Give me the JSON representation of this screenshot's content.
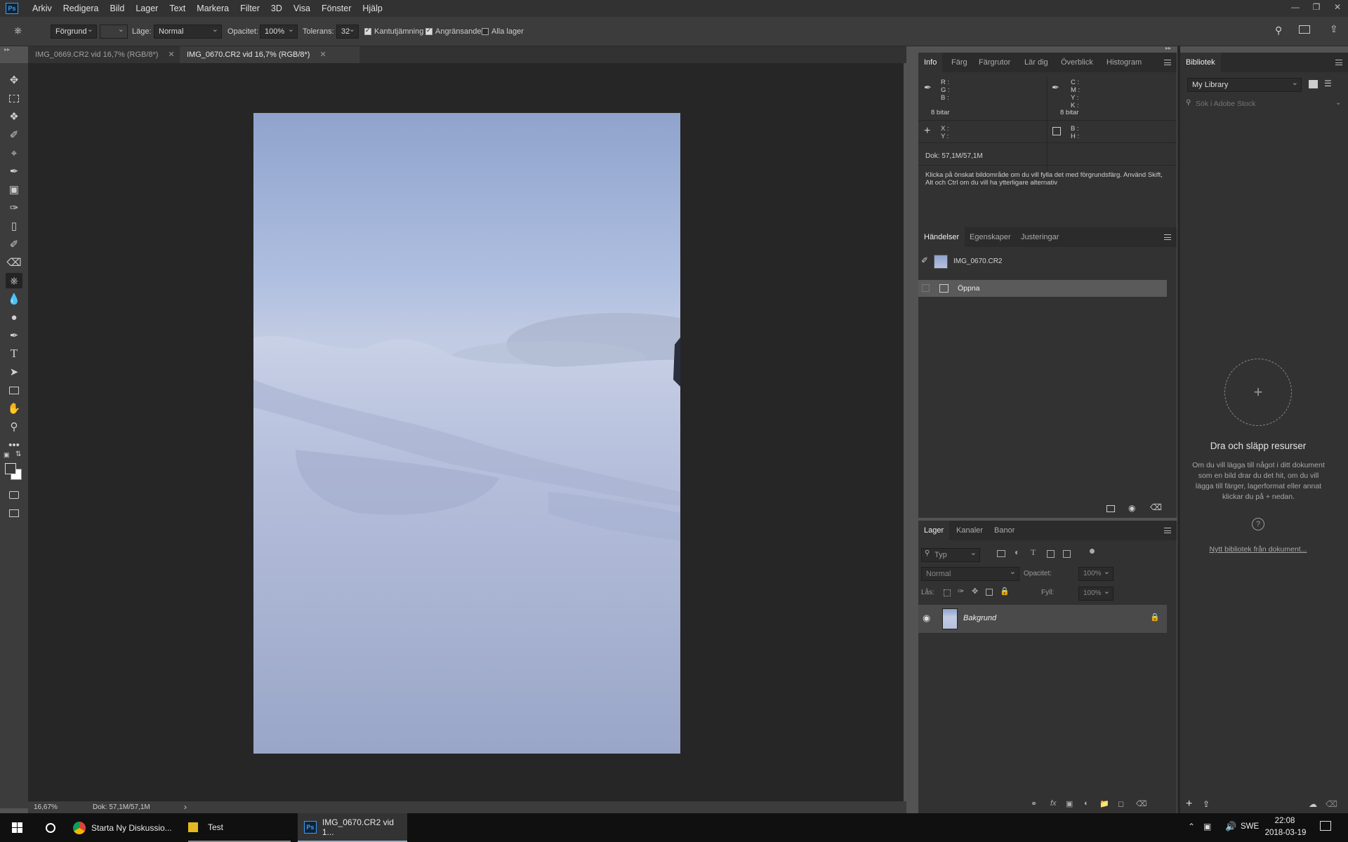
{
  "app": {
    "logo": "Ps",
    "menu": [
      "Arkiv",
      "Redigera",
      "Bild",
      "Lager",
      "Text",
      "Markera",
      "Filter",
      "3D",
      "Visa",
      "Fönster",
      "Hjälp"
    ]
  },
  "options": {
    "fill_source": "Förgrund",
    "mode_label": "Läge:",
    "mode_value": "Normal",
    "opacity_label": "Opacitet:",
    "opacity_value": "100%",
    "tolerance_label": "Tolerans:",
    "tolerance_value": "32",
    "antialias_label": "Kantutjämning",
    "contiguous_label": "Angränsande",
    "all_layers_label": "Alla lager"
  },
  "tabs": [
    {
      "label": "IMG_0669.CR2 vid 16,7% (RGB/8*)"
    },
    {
      "label": "IMG_0670.CR2 vid 16,7% (RGB/8*)"
    }
  ],
  "status": {
    "zoom": "16,67%",
    "doc": "Dok: 57,1M/57,1M",
    "arrow": "›"
  },
  "info_panel": {
    "tabs": [
      "Info",
      "Färg",
      "Färgrutor",
      "Lär dig",
      "Överblick",
      "Histogram"
    ],
    "rgb": "R :\nG :\nB :",
    "cmyk": "C :\nM :\nY :\nK :",
    "bits_left": "8 bitar",
    "bits_right": "8 bitar",
    "xy": "X :\nY :",
    "bh": "B :\nH :",
    "doc": "Dok: 57,1M/57,1M",
    "hint": "Klicka på önskat bildområde om du vill fylla det med förgrundsfärg. Använd Skift, Alt och Ctrl om du vill ha ytterligare alternativ"
  },
  "history_panel": {
    "tabs": [
      "Händelser",
      "Egenskaper",
      "Justeringar"
    ],
    "snapshot": "IMG_0670.CR2",
    "items": [
      "Öppna"
    ]
  },
  "layers_panel": {
    "tabs": [
      "Lager",
      "Kanaler",
      "Banor"
    ],
    "filter": "Typ",
    "blend": "Normal",
    "opacity_label": "Opacitet:",
    "opacity_value": "100%",
    "lock_label": "Lås:",
    "fill_label": "Fyll:",
    "fill_value": "100%",
    "layers": [
      {
        "name": "Bakgrund"
      }
    ]
  },
  "library_panel": {
    "tab": "Bibliotek",
    "library": "My Library",
    "search_placeholder": "Sök i Adobe Stock",
    "drop_title": "Dra och släpp resurser",
    "drop_text": "Om du vill lägga till något i ditt dokument som en bild drar du det hit, om du vill lägga till färger, lagerformat eller annat klickar du på + nedan.",
    "new_link": "Nytt bibliotek från dokument..."
  },
  "taskbar": {
    "items": [
      {
        "label": "Starta Ny Diskussio..."
      },
      {
        "label": "Test"
      },
      {
        "label": "IMG_0670.CR2 vid 1..."
      }
    ],
    "lang": "SWE",
    "time": "22:08",
    "date": "2018-03-19"
  },
  "colors": {
    "fg": "#3a3a3a",
    "bg": "#ffffff",
    "accent": "#3e9cf7"
  }
}
